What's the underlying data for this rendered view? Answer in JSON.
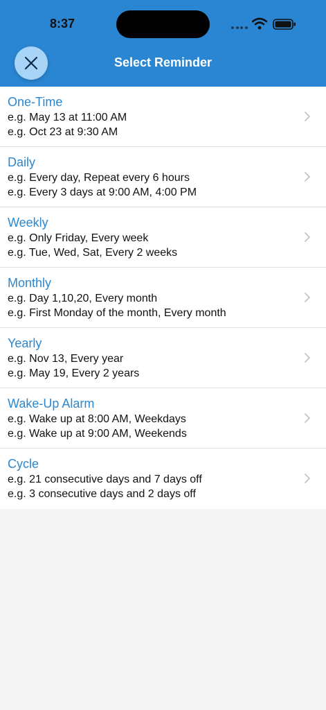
{
  "status": {
    "time": "8:37"
  },
  "header": {
    "title": "Select Reminder"
  },
  "reminders": [
    {
      "title": "One-Time",
      "line1": "e.g. May 13 at 11:00 AM",
      "line2": "e.g. Oct 23 at 9:30 AM"
    },
    {
      "title": "Daily",
      "line1": "e.g. Every day, Repeat every 6 hours",
      "line2": "e.g. Every 3 days at 9:00 AM, 4:00 PM"
    },
    {
      "title": "Weekly",
      "line1": "e.g. Only Friday, Every week",
      "line2": "e.g. Tue, Wed, Sat, Every 2 weeks"
    },
    {
      "title": "Monthly",
      "line1": "e.g. Day 1,10,20, Every month",
      "line2": "e.g. First Monday of the month, Every month"
    },
    {
      "title": "Yearly",
      "line1": "e.g. Nov 13, Every year",
      "line2": "e.g. May 19, Every 2 years"
    },
    {
      "title": "Wake-Up Alarm",
      "line1": "e.g. Wake up at 8:00 AM, Weekdays",
      "line2": "e.g. Wake up at 9:00 AM, Weekends"
    },
    {
      "title": "Cycle",
      "line1": "e.g. 21 consecutive days and 7 days off",
      "line2": "e.g. 3 consecutive days and 2 days off"
    }
  ],
  "colors": {
    "header_bg": "#2a86d2",
    "title_blue": "#2b87cf",
    "close_button_bg": "#a8d4f7",
    "page_bg": "#f5f5f5"
  },
  "icons": {
    "close": "close-icon",
    "chevron": "chevron-right-icon",
    "wifi": "wifi-icon",
    "battery": "battery-icon"
  }
}
